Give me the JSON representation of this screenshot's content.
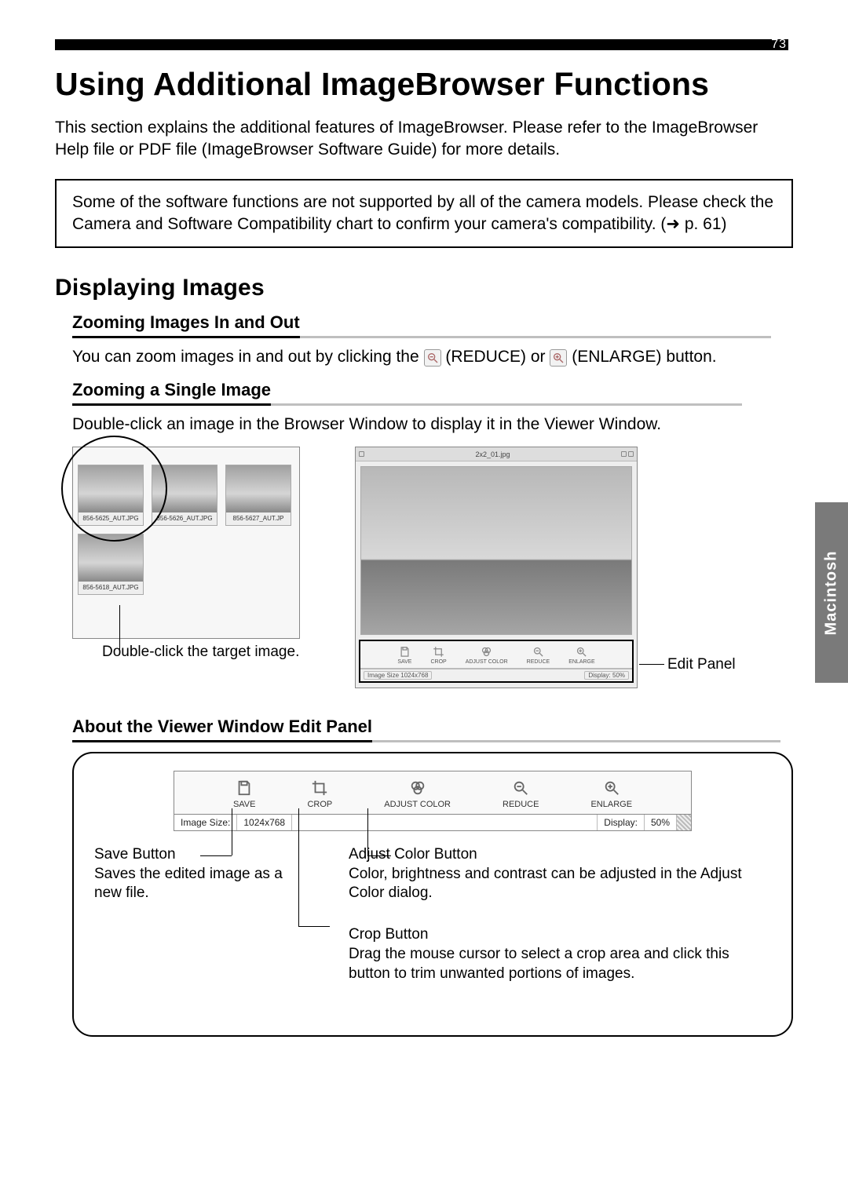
{
  "page_number": "73",
  "title": "Using Additional ImageBrowser Functions",
  "intro": "This section explains the additional features of ImageBrowser. Please refer to the ImageBrowser Help file or PDF file (ImageBrowser Software Guide) for more details.",
  "note": "Some of the software functions are not supported by all of the camera models. Please check the Camera and Software Compatibility chart to confirm your camera's compatibility. (➜ p. 61)",
  "section_title": "Displaying Images",
  "sub1_title": "Zooming Images In and Out",
  "sub1_pre": "You can zoom images in and out by clicking the ",
  "sub1_reduce": " (REDUCE) or ",
  "sub1_enlarge": " (ENLARGE) button.",
  "sub2_title": "Zooming a Single Image",
  "sub2_text": "Double-click an image in the Browser Window to display it in the Viewer Window.",
  "fig_left_caption": "Double-click the target image.",
  "fig_right_label": "Edit Panel",
  "viewer_title": "2x2_01.jpg",
  "viewer_status_left": "Image Size   1024x768",
  "viewer_status_right": "Display:   50%",
  "thumbs": [
    "856-5625_AUT.JPG",
    "856-5626_AUT.JPG",
    "856-5627_AUT.JP",
    "856-5618_AUT.JPG"
  ],
  "tb": {
    "save": "SAVE",
    "crop": "CROP",
    "adjust": "ADJUST COLOR",
    "reduce": "REDUCE",
    "enlarge": "ENLARGE"
  },
  "panel_title": "About the Viewer Window Edit Panel",
  "ep_status": {
    "left_label": "Image Size:",
    "left_value": "1024x768",
    "right_label": "Display:",
    "right_value": "50%"
  },
  "callouts": {
    "save_title": "Save Button",
    "save_desc": "Saves the edited image as a new file.",
    "adjust_title": "Adjust Color Button",
    "adjust_desc": "Color, brightness and contrast can be adjusted in the Adjust Color dialog.",
    "crop_title": "Crop Button",
    "crop_desc": "Drag the mouse cursor to select a crop area and click this button to trim unwanted portions of images."
  },
  "side_tab": "Macintosh"
}
